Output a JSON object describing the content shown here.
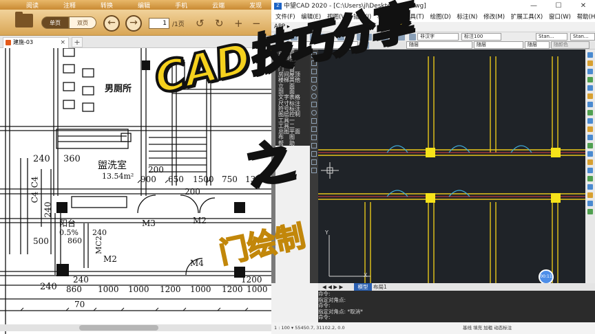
{
  "reader": {
    "menu": [
      "阅读",
      "注释",
      "转换",
      "编辑",
      "手机",
      "云端",
      "发现"
    ],
    "view_single": "单页",
    "view_double": "双页",
    "page_input": "1",
    "page_total": "/1页",
    "tab_name": "建施-03",
    "tab_close": "×",
    "tab_add": "+"
  },
  "drawing": {
    "room1_name": "男厕所",
    "room2_name": "盥洗室",
    "room2_area": "13.54m²",
    "balcony": "阳台",
    "slope": "0.5%",
    "dims": [
      "240",
      "360",
      "200",
      "900",
      "650",
      "1500",
      "750",
      "1300",
      "200",
      "240",
      "860",
      "500",
      "240",
      "860",
      "1000",
      "1000",
      "1200",
      "1000",
      "1200",
      "1000",
      "1200",
      "70",
      "240",
      "240"
    ],
    "labels": [
      "C4",
      "C4",
      "M3",
      "M2",
      "MC2",
      "M2",
      "M4"
    ]
  },
  "cad": {
    "title": "中望CAD 2020 - [C:\\Users\\jl\\Desktop\\111.dwg]",
    "logo": "Z",
    "win_min": "—",
    "win_max": "☐",
    "win_close": "✕",
    "menu": [
      "文件(F)",
      "编辑(E)",
      "视图(V)",
      "插入(I)",
      "格式(O)",
      "工具(T)",
      "绘图(D)",
      "标注(N)",
      "修改(M)",
      "扩展工具(X)",
      "窗口(W)",
      "帮助(H)"
    ],
    "app_label": "APP ▸",
    "dropdowns": {
      "font": "非汉字",
      "dim": "标注100",
      "style": "Stan...",
      "style2": "Stan...",
      "layer": "0",
      "bylayer1": "随层",
      "bylayer2": "随层",
      "bylayer3": "随层",
      "color": "随颜色"
    },
    "panel_items": [
      "设　置",
      "轴网柱子",
      "墙　体",
      "门　窗",
      "房间屋顶",
      "楼梯其他",
      "立　面",
      "剖　面",
      "文字表格",
      "尺寸标注",
      "符号标注",
      "图层控制",
      "工具一",
      "工具二",
      "总图平面",
      "布　图",
      "帮　助"
    ],
    "tabs": {
      "model": "模型",
      "layout": "布局1"
    },
    "cmd_lines": [
      "命令:",
      "指定对角点:",
      "命令:",
      "指定对角点: *取消*",
      "命令:"
    ],
    "status_coords": "1 : 100 ▾  55450.7, 31102.2, 0.0",
    "status_right": "基线  填充  加粗  动态标注",
    "timer": "00:11"
  },
  "overlay": {
    "title": "CAD技巧分享",
    "zhi": "之",
    "subtitle": "门绘制"
  },
  "colors": {
    "reader_bar": "#d9a656",
    "cad_canvas": "#1f2328",
    "wall_yellow": "#e8c81a",
    "overlay_yellow": "#f5d11d"
  }
}
